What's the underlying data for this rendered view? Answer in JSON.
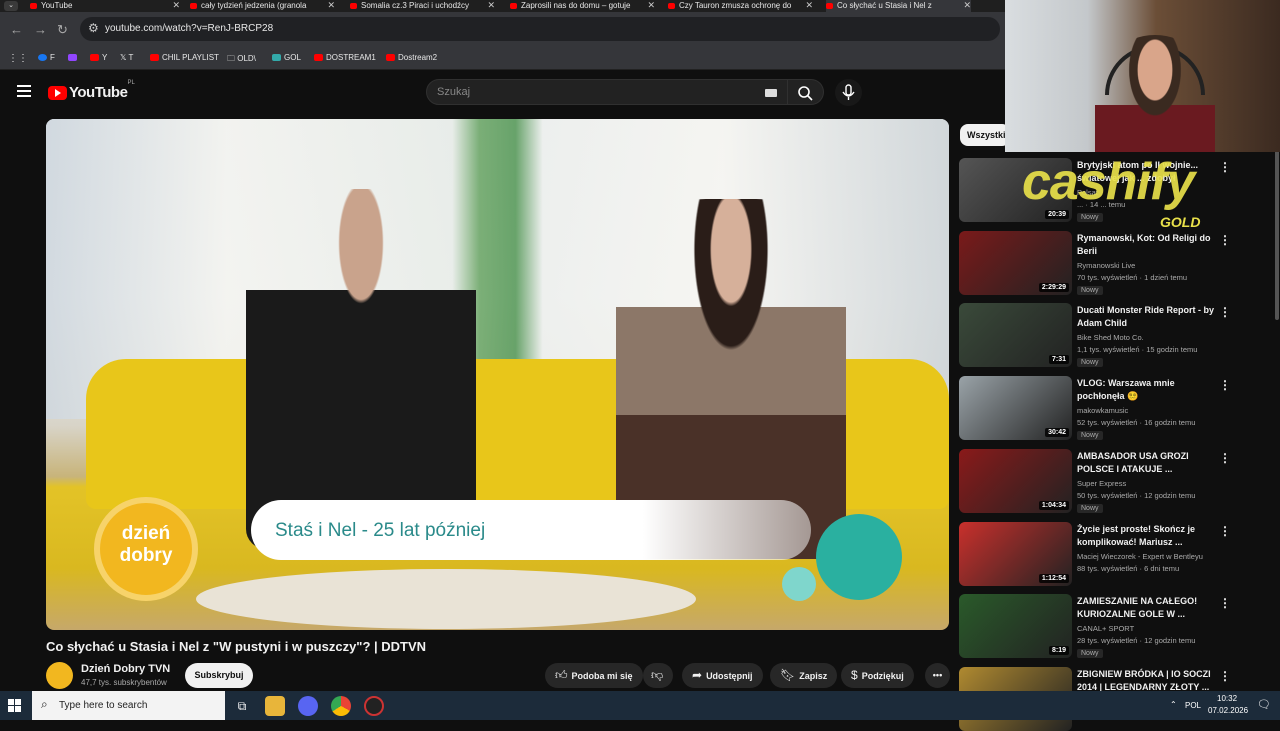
{
  "tabs": [
    {
      "label": "YouTube"
    },
    {
      "label": "cały tydzień jedzenia (granola"
    },
    {
      "label": "Somalia cz.3 Piraci i uchodźcy"
    },
    {
      "label": "Zaprosili nas do domu – gotuje"
    },
    {
      "label": "Czy Tauron zmusza ochronę do"
    },
    {
      "label": "Co słychać u Stasia i Nel z"
    }
  ],
  "address": {
    "url": "youtube.com/watch?v=RenJ-BRCP28"
  },
  "bookmarks": [
    {
      "label": "F"
    },
    {
      "label": "Y"
    },
    {
      "label": "T"
    },
    {
      "label": "CHIL PLAYLIST"
    },
    {
      "label": "OLD\\"
    },
    {
      "label": "GOL"
    },
    {
      "label": "DOSTREAM1"
    },
    {
      "label": "Dostream2"
    }
  ],
  "yt": {
    "logo_text": "YouTube",
    "region": "PL",
    "search_placeholder": "Szukaj"
  },
  "video": {
    "lower_third": "Staś i Nel - 25 lat później",
    "logo_line1": "dzień",
    "logo_line2": "dobry",
    "title": "Co słychać u Stasia i Nel z \"W pustyni i w puszczy\"? | DDTVN",
    "channel": "Dzień Dobry TVN",
    "subscribers": "47,7 tys. subskrybentów",
    "subscribe_label": "Subskrybuj",
    "like_label": "Podoba mi się",
    "share_label": "Udostępnij",
    "save_label": "Zapisz",
    "thanks_label": "Podziękuj"
  },
  "sidebar": {
    "chip": "Wszystkie",
    "items": [
      {
        "title": "Brytyjski atom po II wojnie... światowej jak ... zdobył",
        "channel": "Polsat",
        "meta": "... · 14 ... temu",
        "badge": "Nowy",
        "duration": "20:39",
        "color": "#555"
      },
      {
        "title": "Rymanowski, Kot: Od Religi do Berii",
        "channel": "Rymanowski Live",
        "meta": "70 tys. wyświetleń · 1 dzień temu",
        "badge": "Nowy",
        "duration": "2:29:29",
        "color": "#7a1a1a"
      },
      {
        "title": "Ducati Monster Ride Report - by Adam Child",
        "channel": "Bike Shed Moto Co.",
        "meta": "1,1 tys. wyświetleń · 15 godzin temu",
        "badge": "Nowy",
        "duration": "7:31",
        "color": "#3a4a3a"
      },
      {
        "title": "VLOG: Warszawa mnie pochłonęła 😵‍💫",
        "channel": "makowkamusic",
        "meta": "52 tys. wyświetleń · 16 godzin temu",
        "badge": "Nowy",
        "duration": "30:42",
        "color": "#9aa3a8"
      },
      {
        "title": "AMBASADOR USA GROZI POLSCE I ATAKUJE ...",
        "channel": "Super Express",
        "meta": "50 tys. wyświetleń · 12 godzin temu",
        "badge": "Nowy",
        "duration": "1:04:34",
        "color": "#8a1a1a"
      },
      {
        "title": "Życie jest proste! Skończ je komplikować! Mariusz ...",
        "channel": "Maciej Wieczorek - Expert w Bentleyu",
        "meta": "88 tys. wyświetleń · 6 dni temu",
        "badge": "",
        "duration": "1:12:54",
        "color": "#c9302c"
      },
      {
        "title": "ZAMIESZANIE NA CAŁEGO! KURIOZALNE GOLE W ...",
        "channel": "CANAL+ SPORT",
        "meta": "28 tys. wyświetleń · 12 godzin temu",
        "badge": "Nowy",
        "duration": "8:19",
        "color": "#2a5a2a"
      },
      {
        "title": "ZBIGNIEW BRÓDKA | IO SOCZI 2014 | LEGENDARNY ZŁOTY ...",
        "channel": "",
        "meta": "",
        "badge": "",
        "duration": "",
        "color": "#b08a30"
      }
    ]
  },
  "overlay": {
    "brand": "cashify",
    "tier": "GOLD"
  },
  "taskbar": {
    "search_placeholder": "Type here to search",
    "lang": "POL",
    "time": "10:32",
    "date": "07.02.2026"
  }
}
